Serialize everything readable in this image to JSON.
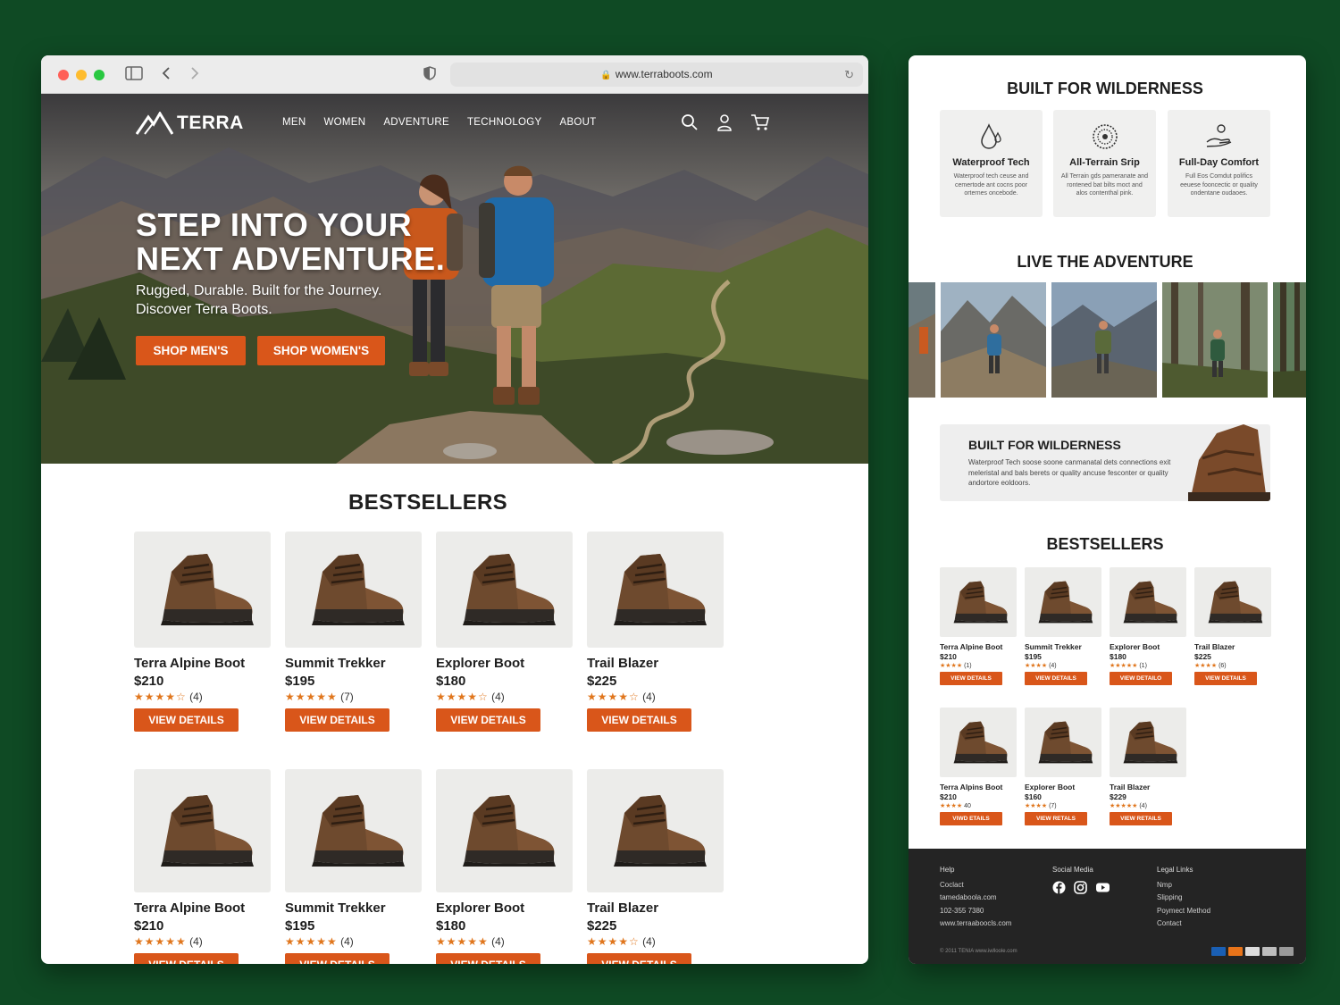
{
  "browser": {
    "url": "www.terraboots.com"
  },
  "nav": {
    "logo_text": "TERRA",
    "items": [
      "MEN",
      "WOMEN",
      "ADVENTURE",
      "TECHNOLOGY",
      "ABOUT"
    ]
  },
  "hero": {
    "title": "STEP INTO YOUR\nNEXT ADVENTURE.",
    "subtitle": "Rugged, Durable. Built for the Journey.\nDiscover Terra Boots.",
    "btn_men": "SHOP MEN'S",
    "btn_women": "SHOP WOMEN'S"
  },
  "bestsellers": {
    "title": "BESTSELLERS",
    "btn_label": "VIEW DETAILS",
    "products": [
      {
        "name": "Terra Alpine Boot",
        "price": "$210",
        "reviews": "(4)",
        "rating": 4.5
      },
      {
        "name": "Summit Trekker",
        "price": "$195",
        "reviews": "(7)",
        "rating": 5
      },
      {
        "name": "Explorer Boot",
        "price": "$180",
        "reviews": "(4)",
        "rating": 4.5
      },
      {
        "name": "Trail Blazer",
        "price": "$225",
        "reviews": "(4)",
        "rating": 4.5
      },
      {
        "name": "Terra Alpine Boot",
        "price": "$210",
        "reviews": "(4)",
        "rating": 5
      },
      {
        "name": "Summit Trekker",
        "price": "$195",
        "reviews": "(4)",
        "rating": 5
      },
      {
        "name": "Explorer Boot",
        "price": "$180",
        "reviews": "(4)",
        "rating": 5
      },
      {
        "name": "Trail Blazer",
        "price": "$225",
        "reviews": "(4)",
        "rating": 4.5
      }
    ]
  },
  "mobile": {
    "features_title": "BUILT FOR WILDERNESS",
    "features": [
      {
        "name": "Waterproof Tech",
        "desc": "Waterproof tech ceuse and cemertode ant cocns poor orternes oncebode.",
        "icon": "water-drop-icon"
      },
      {
        "name": "All-Terrain Srip",
        "desc": "All Terrain gds pameranate and rontened bat bilts moct and alos contenthal pink.",
        "icon": "tread-icon"
      },
      {
        "name": "Full-Day Comfort",
        "desc": "Full Eos Comdut polifics eeuese fooncectic or quality ondentane oudaoes.",
        "icon": "hand-comfort-icon"
      }
    ],
    "adventure_title": "LIVE THE ADVENTURE",
    "banner_title": "BUILT FOR WILDERNESS",
    "banner_desc": "Waterproof Tech soose soone canmanatal dets connections exit meleristal and bals berets or quality ancuse fesconter or quality andortore eoldoors.",
    "bestsellers_title": "BESTSELLERS",
    "products": [
      {
        "name": "Terra Alpine Boot",
        "price": "$210",
        "stars": "★★★★",
        "reviews": "(1)",
        "btn": "VIEW DETAILS"
      },
      {
        "name": "Summit Trekker",
        "price": "$195",
        "stars": "★★★★",
        "reviews": "(4)",
        "btn": "VIEW DETAILS"
      },
      {
        "name": "Explorer Boot",
        "price": "$180",
        "stars": "★★★★★",
        "reviews": "(1)",
        "btn": "VIEW DETAILO"
      },
      {
        "name": "Trail Blazer",
        "price": "$225",
        "stars": "★★★★",
        "reviews": "(6)",
        "btn": "VIEW DETAILS"
      },
      {
        "name": "Terra Alpins Boot",
        "price": "$210",
        "stars": "★★★★",
        "reviews": "40",
        "btn": "VIWD ETAILS"
      },
      {
        "name": "Explorer Boot",
        "price": "$160",
        "stars": "★★★★",
        "reviews": "(7)",
        "btn": "VIEW RETALS"
      },
      {
        "name": "Trail Blazer",
        "price": "$229",
        "stars": "★★★★★",
        "reviews": "(4)",
        "btn": "VIEW RETAILS"
      }
    ],
    "footer": {
      "col1_title": "Help",
      "col1": [
        "Coclact",
        "tamedaboola.com",
        "102-355 7380",
        "www.terraaboocls.com"
      ],
      "col2_title": "Social Media",
      "col3_title": "Legal Links",
      "col3": [
        "Nmp",
        "Slipping",
        "Poymect Method",
        "Contact"
      ],
      "copyright": "© 2011 TENIA  www.iwlloole.com"
    }
  },
  "colors": {
    "accent": "#d9561a",
    "star": "#e0761d",
    "background": "#0f4a24",
    "footer": "#242424"
  }
}
